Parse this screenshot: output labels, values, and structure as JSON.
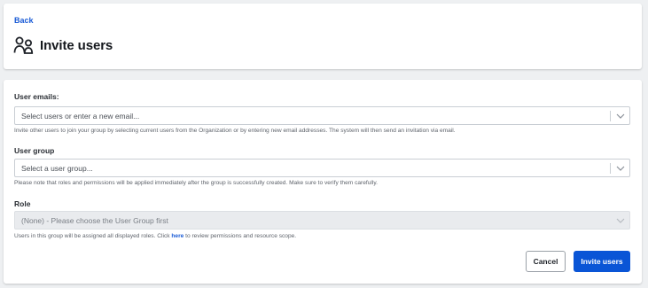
{
  "header": {
    "back_label": "Back",
    "title": "Invite users",
    "title_icon": "users-icon"
  },
  "form": {
    "emails": {
      "label": "User emails:",
      "placeholder": "Select users or enter a new email...",
      "helper": "Invite other users to join your group by selecting current users from the Organization or by entering new email addresses. The system will then send an invitation via email."
    },
    "group": {
      "label": "User group",
      "placeholder": "Select a user group...",
      "helper": "Please note that roles and permissions will be applied immediately after the group is successfully created. Make sure to verify them carefully."
    },
    "role": {
      "label": "Role",
      "value": "(None) - Please choose the User Group first",
      "disabled": true,
      "helper_before": "Users in this group will be assigned all displayed roles. Click ",
      "helper_link": "here",
      "helper_after": " to review permissions and resource scope."
    }
  },
  "actions": {
    "cancel_label": "Cancel",
    "invite_label": "Invite users"
  },
  "colors": {
    "accent": "#0a55d6",
    "link": "#1a5bd6",
    "background": "#eef0f2",
    "disabled_field": "#e9ebee"
  }
}
